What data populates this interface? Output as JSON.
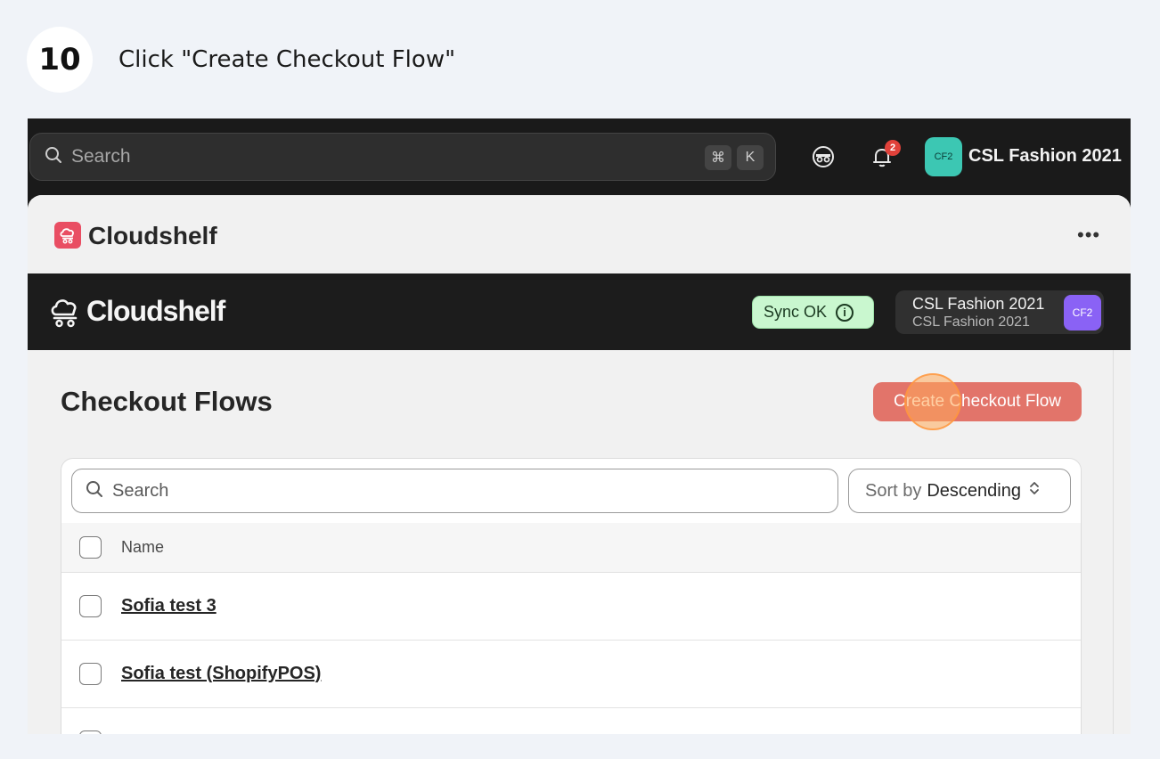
{
  "step": {
    "number": "10",
    "instruction": "Click \"Create Checkout Flow\""
  },
  "topbar": {
    "search_placeholder": "Search",
    "shortcut_keys": [
      "⌘",
      "K"
    ],
    "notification_count": "2",
    "store_avatar": "CF2",
    "store_name": "CSL Fashion 2021"
  },
  "app_header": {
    "app_name": "Cloudshelf",
    "more": "•••"
  },
  "cloudshelf_bar": {
    "logo_text": "Cloudshelf",
    "sync_status": "Sync OK",
    "store_name": "CSL Fashion 2021",
    "store_subname": "CSL Fashion 2021",
    "store_avatar": "CF2"
  },
  "page": {
    "title": "Checkout Flows",
    "create_button": "Create Checkout Flow",
    "search_placeholder": "Search",
    "sort_prefix": "Sort by",
    "sort_value": "Descending",
    "column_name": "Name",
    "rows": [
      "Sofia test 3",
      "Sofia test (ShopifyPOS)"
    ]
  },
  "colors": {
    "accent": "#e2746a",
    "sync_ok": "#c9f7cf",
    "store_avatar_top": "#3cc7b3",
    "store_avatar_bar": "#8a62f5",
    "brand_logo": "#e94e63"
  }
}
